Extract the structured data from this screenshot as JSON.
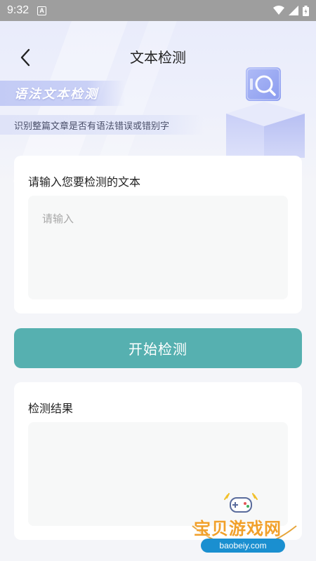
{
  "status_bar": {
    "time": "9:32",
    "notification_icon": "a-icon"
  },
  "header": {
    "title": "文本检测",
    "back_icon": "chevron-left-icon"
  },
  "banner": {
    "title": "语法文本检测",
    "subtitle": "识别整篇文章是否有语法错误或错别字"
  },
  "input_card": {
    "label": "请输入您要检测的文本",
    "placeholder": "请输入",
    "value": ""
  },
  "actions": {
    "start_label": "开始检测"
  },
  "result_card": {
    "label": "检测结果",
    "value": ""
  },
  "watermark": {
    "text": "宝贝游戏网",
    "url": "baobeiy.com"
  },
  "colors": {
    "accent": "#56b0b0",
    "hero_bg": "#e9ecfb",
    "banner_title_bg": "#c3cbf5",
    "card_bg": "#ffffff",
    "field_bg": "#f7f8f8"
  }
}
